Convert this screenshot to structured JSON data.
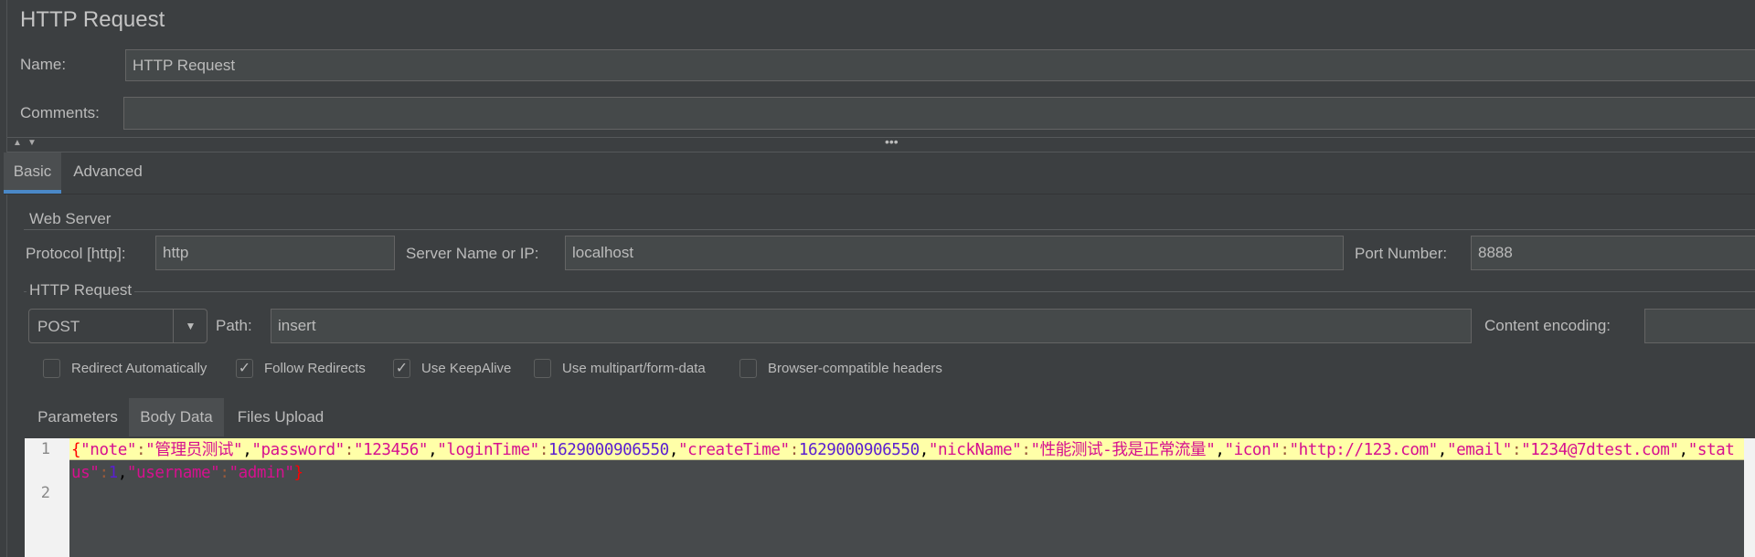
{
  "panel": {
    "title": "HTTP Request"
  },
  "name": {
    "label": "Name:",
    "value": "HTTP Request"
  },
  "comments": {
    "label": "Comments:",
    "value": ""
  },
  "splitter": {
    "dots": "•••"
  },
  "tabs": [
    {
      "label": "Basic",
      "active": true
    },
    {
      "label": "Advanced",
      "active": false
    }
  ],
  "web_server": {
    "legend": "Web Server",
    "protocol_label": "Protocol [http]:",
    "protocol_value": "http",
    "server_label": "Server Name or IP:",
    "server_value": "localhost",
    "port_label": "Port Number:",
    "port_value": "8888"
  },
  "http_request": {
    "legend": "HTTP Request",
    "method": "POST",
    "path_label": "Path:",
    "path_value": "insert",
    "encoding_label": "Content encoding:",
    "encoding_value": ""
  },
  "checkboxes": [
    {
      "label": "Redirect Automatically",
      "checked": false
    },
    {
      "label": "Follow Redirects",
      "checked": true
    },
    {
      "label": "Use KeepAlive",
      "checked": true
    },
    {
      "label": "Use multipart/form-data",
      "checked": false
    },
    {
      "label": "Browser-compatible headers",
      "checked": false
    }
  ],
  "subtabs": [
    {
      "label": "Parameters",
      "active": false
    },
    {
      "label": "Body Data",
      "active": true
    },
    {
      "label": "Files Upload",
      "active": false
    }
  ],
  "body_data": {
    "line_numbers": [
      "1",
      "2"
    ],
    "line1": "{\"note\":\"管理员测试\",\"password\":\"123456\",\"loginTime\":1629000906550,\"createTime\":1629000906550,\"nickName\":\"性能测试-我是正常流量\",\"icon\":\"http://123.com\",\"email\":\"1234@7dtest.com\",\"status\":1,\"username\":\"admin\"}"
  },
  "colors": {
    "background": "#3c3f41",
    "accent": "#4a88c7",
    "string": "#d6108f",
    "number": "#5a1fd0",
    "brace": "#ff0000",
    "punct": "#000000",
    "line_highlight": "#ffffa8"
  }
}
